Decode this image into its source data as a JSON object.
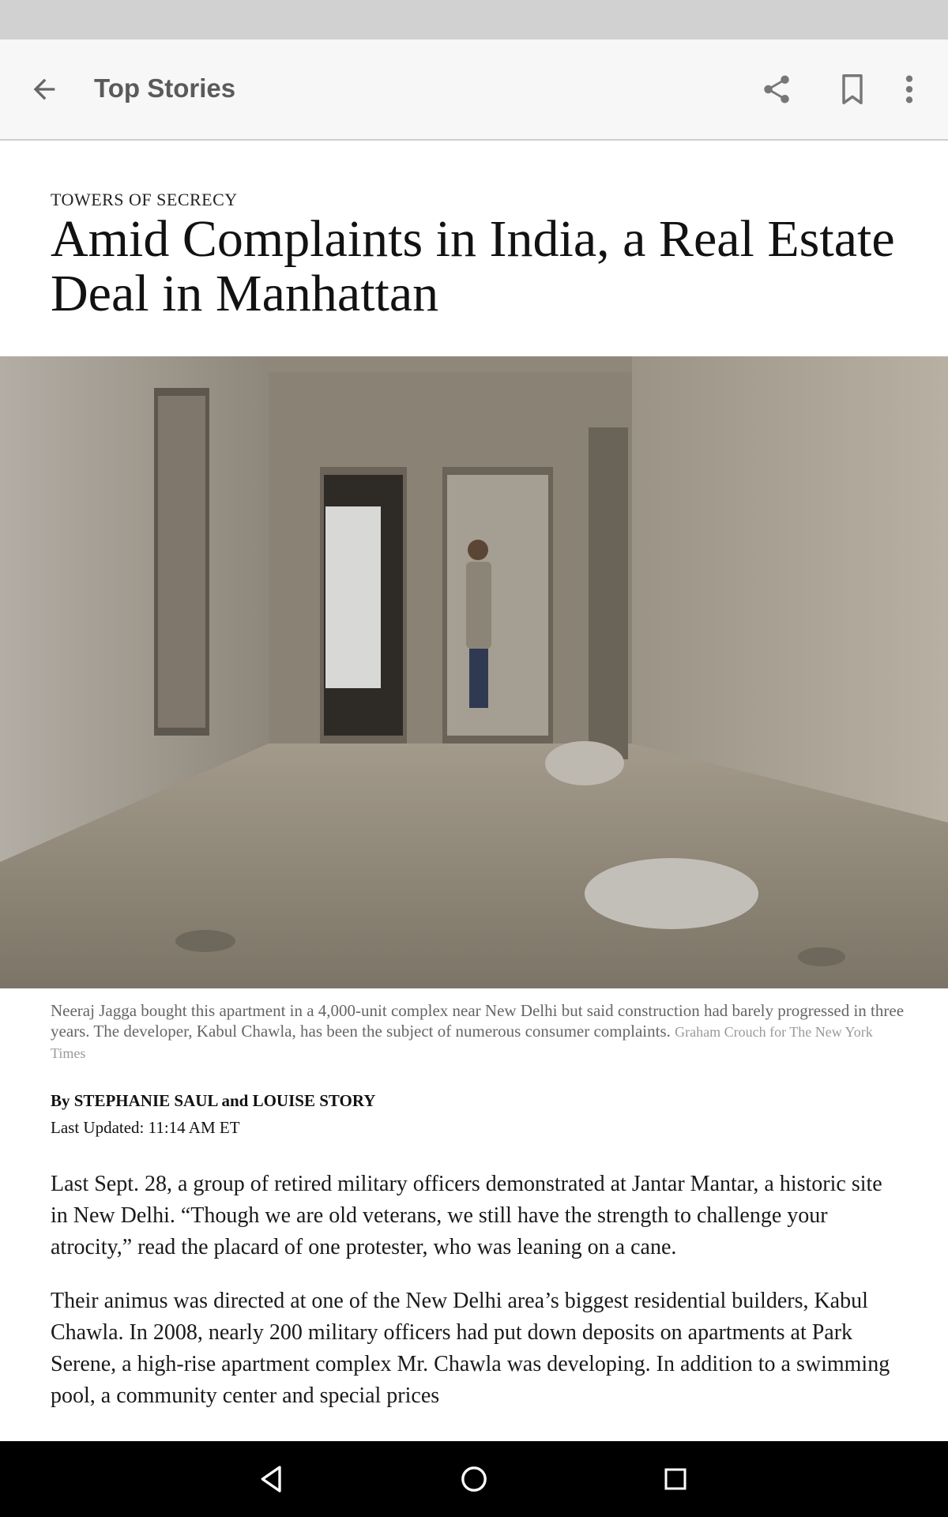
{
  "app_bar": {
    "title": "Top Stories",
    "icons": [
      "arrow-left-icon",
      "share-icon",
      "bookmark-icon",
      "more-vert-icon"
    ]
  },
  "article": {
    "kicker": "TOWERS OF SECRECY",
    "headline": "Amid Complaints in India, a Real Estate Deal in Manhattan",
    "caption": "Neeraj Jagga bought this apartment in a 4,000-unit complex near New Delhi but said construction had barely progressed in three years. The developer, Kabul Chawla, has been the subject of numerous consumer complaints.",
    "photo_credit": "Graham Crouch for The New York Times",
    "byline": "By STEPHANIE SAUL and LOUISE STORY",
    "updated": "Last Updated: 11:14 AM ET",
    "paragraphs": [
      "Last Sept. 28, a group of retired military officers demonstrated at Jantar Mantar, a historic site in New Delhi. “Though we are old veterans, we still have the strength to challenge your atrocity,” read the placard of one protester, who was leaning on a cane.",
      "Their animus was directed at one of the New Delhi area’s biggest residential builders, Kabul Chawla. In 2008, nearly 200 military officers had put down deposits on apartments at Park Serene, a high-rise apartment complex Mr. Chawla was developing. In addition to a swimming pool, a community center and special prices"
    ]
  },
  "nav_bar": {
    "icons": [
      "nav-back-icon",
      "nav-home-icon",
      "nav-recents-icon"
    ]
  },
  "colors": {
    "app_bar_bg": "#f7f7f7",
    "status_bar_bg": "#d1d1d1",
    "nav_bar_bg": "#000000",
    "headline_text": "#121212",
    "caption_text": "#666666"
  }
}
